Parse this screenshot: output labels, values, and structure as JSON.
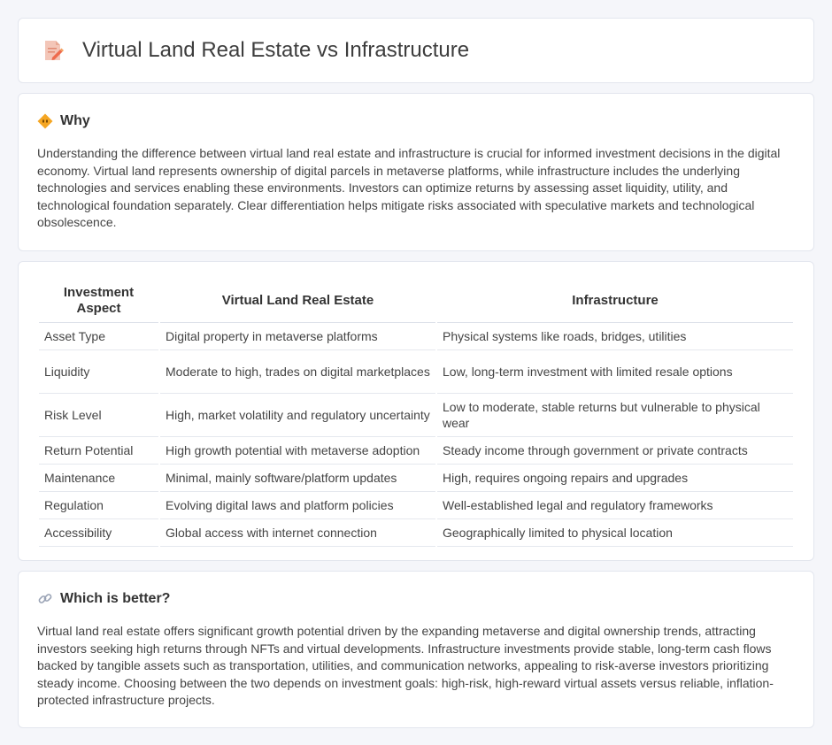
{
  "header": {
    "title": "Virtual Land Real Estate vs Infrastructure"
  },
  "why": {
    "title": "Why",
    "text": "Understanding the difference between virtual land real estate and infrastructure is crucial for informed investment decisions in the digital economy. Virtual land represents ownership of digital parcels in metaverse platforms, while infrastructure includes the underlying technologies and services enabling these environments. Investors can optimize returns by assessing asset liquidity, utility, and technological foundation separately. Clear differentiation helps mitigate risks associated with speculative markets and technological obsolescence."
  },
  "table": {
    "headers": [
      "Investment Aspect",
      "Virtual Land Real Estate",
      "Infrastructure"
    ],
    "rows": [
      [
        "Asset Type",
        "Digital property in metaverse platforms",
        "Physical systems like roads, bridges, utilities"
      ],
      [
        "Liquidity",
        "Moderate to high, trades on digital marketplaces",
        "Low, long-term investment with limited resale options"
      ],
      [
        "Risk Level",
        "High, market volatility and regulatory uncertainty",
        "Low to moderate, stable returns but vulnerable to physical wear"
      ],
      [
        "Return Potential",
        "High growth potential with metaverse adoption",
        "Steady income through government or private contracts"
      ],
      [
        "Maintenance",
        "Minimal, mainly software/platform updates",
        "High, requires ongoing repairs and upgrades"
      ],
      [
        "Regulation",
        "Evolving digital laws and platform policies",
        "Well-established legal and regulatory frameworks"
      ],
      [
        "Accessibility",
        "Global access with internet connection",
        "Geographically limited to physical location"
      ]
    ]
  },
  "better": {
    "title": "Which is better?",
    "text": "Virtual land real estate offers significant growth potential driven by the expanding metaverse and digital ownership trends, attracting investors seeking high returns through NFTs and virtual developments. Infrastructure investments provide stable, long-term cash flows backed by tangible assets such as transportation, utilities, and communication networks, appealing to risk-averse investors prioritizing steady income. Choosing between the two depends on investment goals: high-risk, high-reward virtual assets versus reliable, inflation-protected infrastructure projects."
  },
  "icons": {
    "header": "document-pencil-icon",
    "why": "diamond-sign-icon",
    "better": "link-icon"
  }
}
